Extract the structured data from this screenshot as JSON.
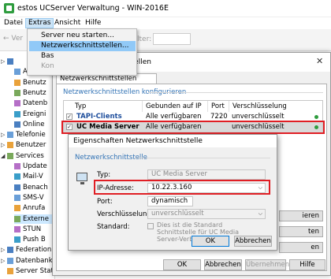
{
  "window": {
    "title": "estos UCServer Verwaltung - WIN-2016E"
  },
  "menubar": {
    "items": [
      "Datei",
      "Extras",
      "Ansicht",
      "Hilfe"
    ]
  },
  "toolbar": {
    "back_label": "Ver",
    "filter_label": "lter:"
  },
  "dropdown": {
    "items": [
      {
        "label": "Server neu starten...",
        "state": "normal"
      },
      {
        "label": "Netzwerkschnittstellen...",
        "state": "highlighted"
      },
      {
        "label": "Bas",
        "state": "normal"
      },
      {
        "label": "Kon",
        "state": "disabled"
      }
    ]
  },
  "tree": {
    "items": [
      {
        "label": "",
        "expand": "▷",
        "indent": 0
      },
      {
        "label": "A",
        "expand": "",
        "indent": 1
      },
      {
        "label": "Benutz",
        "expand": "",
        "indent": 1
      },
      {
        "label": "Benutz",
        "expand": "",
        "indent": 1
      },
      {
        "label": "Datenb",
        "expand": "",
        "indent": 1
      },
      {
        "label": "Ereigni",
        "expand": "",
        "indent": 1
      },
      {
        "label": "Online",
        "expand": "",
        "indent": 1
      },
      {
        "label": "Telefonie",
        "expand": "▷",
        "indent": 0
      },
      {
        "label": "Benutzer",
        "expand": "▷",
        "indent": 0
      },
      {
        "label": "Services",
        "expand": "◢",
        "indent": 0
      },
      {
        "label": "Update",
        "expand": "",
        "indent": 1
      },
      {
        "label": "Mail-V",
        "expand": "",
        "indent": 1
      },
      {
        "label": "Benach",
        "expand": "",
        "indent": 1
      },
      {
        "label": "SMS-V",
        "expand": "",
        "indent": 1
      },
      {
        "label": "Anrufa",
        "expand": "",
        "indent": 1
      },
      {
        "label": "Externe",
        "expand": "",
        "indent": 1
      },
      {
        "label": "STUN",
        "expand": "",
        "indent": 1
      },
      {
        "label": "Push B",
        "expand": "",
        "indent": 1
      },
      {
        "label": "Federation",
        "expand": "▷",
        "indent": 0
      },
      {
        "label": "Datenbank",
        "expand": "▷",
        "indent": 0
      },
      {
        "label": "Server Stat",
        "expand": "",
        "indent": 0
      }
    ]
  },
  "netzwerk": {
    "title": "Netzwerkschnittstellen",
    "tab": "Netzwerkschnittstellen konfigurieren",
    "group_label": "Netzwerkschnittstellen konfigurieren",
    "columns": [
      "Typ",
      "Gebunden auf IP",
      "Port",
      "Verschlüsselung"
    ],
    "rows": [
      {
        "typ": "TAPI-Clients",
        "ip": "Alle verfügbaren",
        "port": "7220",
        "enc": "unverschlüsselt",
        "checked": "✓"
      },
      {
        "typ": "UC Media Server",
        "ip": "Alle verfügbaren",
        "port": "",
        "enc": "unverschlüsselt",
        "checked": "✓"
      }
    ],
    "side_buttons": [
      "ieren",
      "ten",
      "en"
    ],
    "buttons": {
      "ok": "OK",
      "cancel": "Abbrechen",
      "apply": "Übernehmen",
      "help": "Hilfe"
    }
  },
  "dialog": {
    "title": "Eigenschaften Netzwerkschnittstelle",
    "group_label": "Netzwerkschnittstelle",
    "fields": {
      "typ_label": "Typ:",
      "typ_value": "UC Media Server",
      "ip_label": "IP-Adresse:",
      "ip_value": "10.22.3.160",
      "port_label": "Port:",
      "port_value": "dynamisch",
      "enc_label": "Verschlüsselung:",
      "enc_value": "unverschlüsselt",
      "std_label": "Standard:",
      "std_check_label": "Dies ist die Standard Schnittstelle für UC Media Server-Verbindungen"
    },
    "buttons": {
      "ok": "OK",
      "cancel": "Abbrechen"
    }
  },
  "colors": {
    "accent": "#3273b5",
    "highlight_red": "#e01e24",
    "status_green": "#2e9c3e",
    "menu_highlight": "#91c9f7"
  }
}
